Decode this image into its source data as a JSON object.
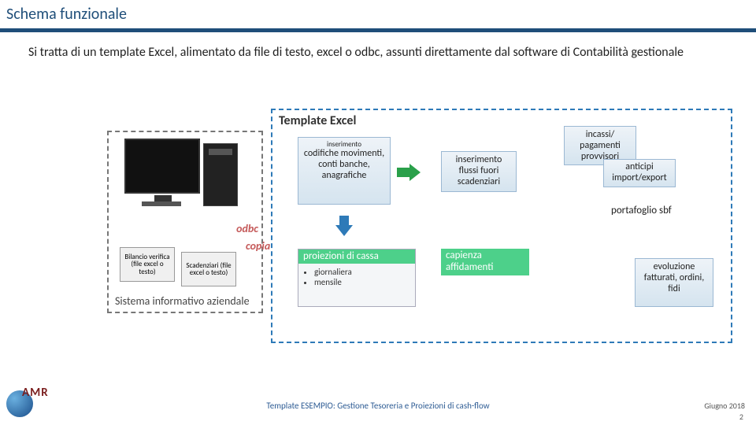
{
  "title": "Schema funzionale",
  "description": "Si tratta di un template Excel, alimentato da file di testo, excel o odbc, assunti direttamente dal software di Contabilità gestionale",
  "odbc_label": "odbc",
  "file1": "Bilancio verifica (file excel o testo)",
  "file2": "Scadenziari (file excel o testo)",
  "sys_label": "Sistema informativo aziendale",
  "template_title": "Template Excel",
  "copia_label": "copia",
  "step1_small": "inserimento",
  "step1": "codifiche movimenti, conti banche, anagrafiche",
  "step2": "inserimento flussi fuori scadenziari",
  "step3": "incassi/ pagamenti provvisori",
  "step4": "anticipi import/export",
  "step5": "portafoglio sbf",
  "step6": "evoluzione fatturati, ordini, fidi",
  "proj_title": "proiezioni di cassa",
  "proj_items": [
    "giornaliera",
    "mensile"
  ],
  "cap": "capienza affidamenti",
  "footer": "Template ESEMPIO: Gestione Tesoreria e Proiezioni di cash-flow",
  "date": "Giugno 2018",
  "page": "2",
  "logo_text": "AMR"
}
